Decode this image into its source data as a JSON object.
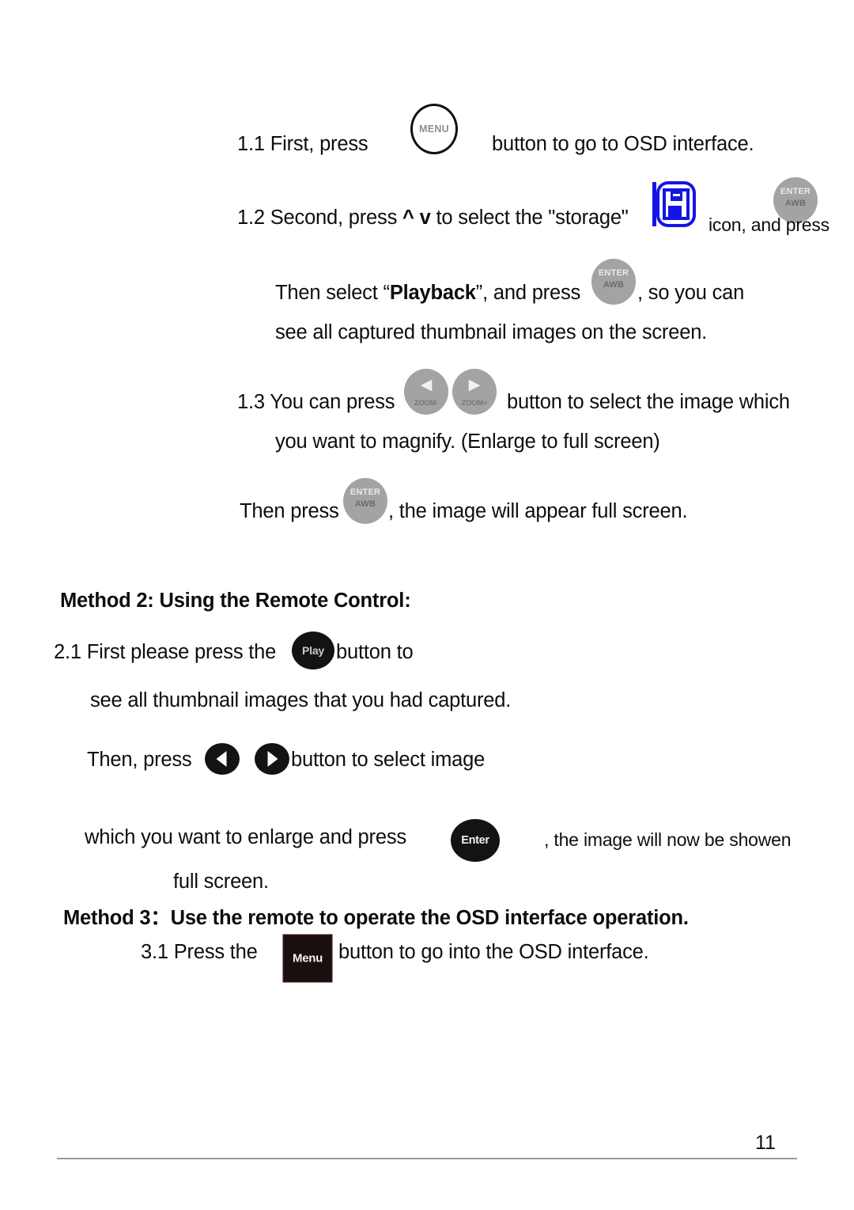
{
  "page": {
    "number": "11"
  },
  "section1": {
    "step_1_1": {
      "prefix": "1.1 First, press",
      "suffix": "button to go to OSD interface.",
      "button_label": "MENU"
    },
    "step_1_2": {
      "prefix": "1.2 Second, press",
      "up_arrow": "^",
      "down_arrow": "v",
      "middle": "to select the \"storage\"",
      "suffix": "icon, and press",
      "storage_icon_name": "storage",
      "enter_label_top": "ENTER",
      "enter_label_bottom": "AWB"
    },
    "step_1_2b": {
      "prefix": "Then select “",
      "bold_word": "Playback",
      "middle": "”, and press",
      "suffix": ", so you can",
      "enter_label_top": "ENTER",
      "enter_label_bottom": "AWB"
    },
    "step_1_2c": {
      "text": "see all captured thumbnail images on the screen."
    },
    "step_1_3": {
      "prefix": "1.3 You can press",
      "suffix": "button to select the image which",
      "zoom_out_label": "ZOOM-",
      "zoom_in_label": "ZOOM+"
    },
    "step_1_3b": {
      "text": "you want to magnify. (Enlarge to full screen)"
    },
    "step_1_3c": {
      "prefix": "Then press",
      "suffix": ", the image will appear full screen.",
      "enter_label_top": "ENTER",
      "enter_label_bottom": "AWB"
    }
  },
  "method2": {
    "heading": "Method 2: Using the Remote Control:",
    "step_2_1": {
      "prefix": "2.1 First please press the",
      "suffix": "button to",
      "play_label": "Play"
    },
    "step_2_1b": {
      "text": "see all thumbnail images that you had captured."
    },
    "step_2_1c": {
      "prefix": "Then, press",
      "suffix": "button to select image"
    },
    "step_2_1d": {
      "prefix": "which you want to enlarge and press",
      "suffix": ", the image will now be showen",
      "enter_label": "Enter"
    },
    "step_2_1e": {
      "text": "full screen."
    }
  },
  "method3": {
    "heading": "Method 3：Use the remote to operate the OSD interface operation.",
    "step_3_1": {
      "prefix": "3.1 Press the",
      "suffix": "button to go into the OSD interface.",
      "menu_label": "Menu"
    }
  },
  "colors": {
    "storage_icon": "#1414e8",
    "grey_button": "#a3a3a3",
    "black_button": "#151212",
    "text": "#0d0d0d",
    "rule": "#9a9a9a"
  }
}
